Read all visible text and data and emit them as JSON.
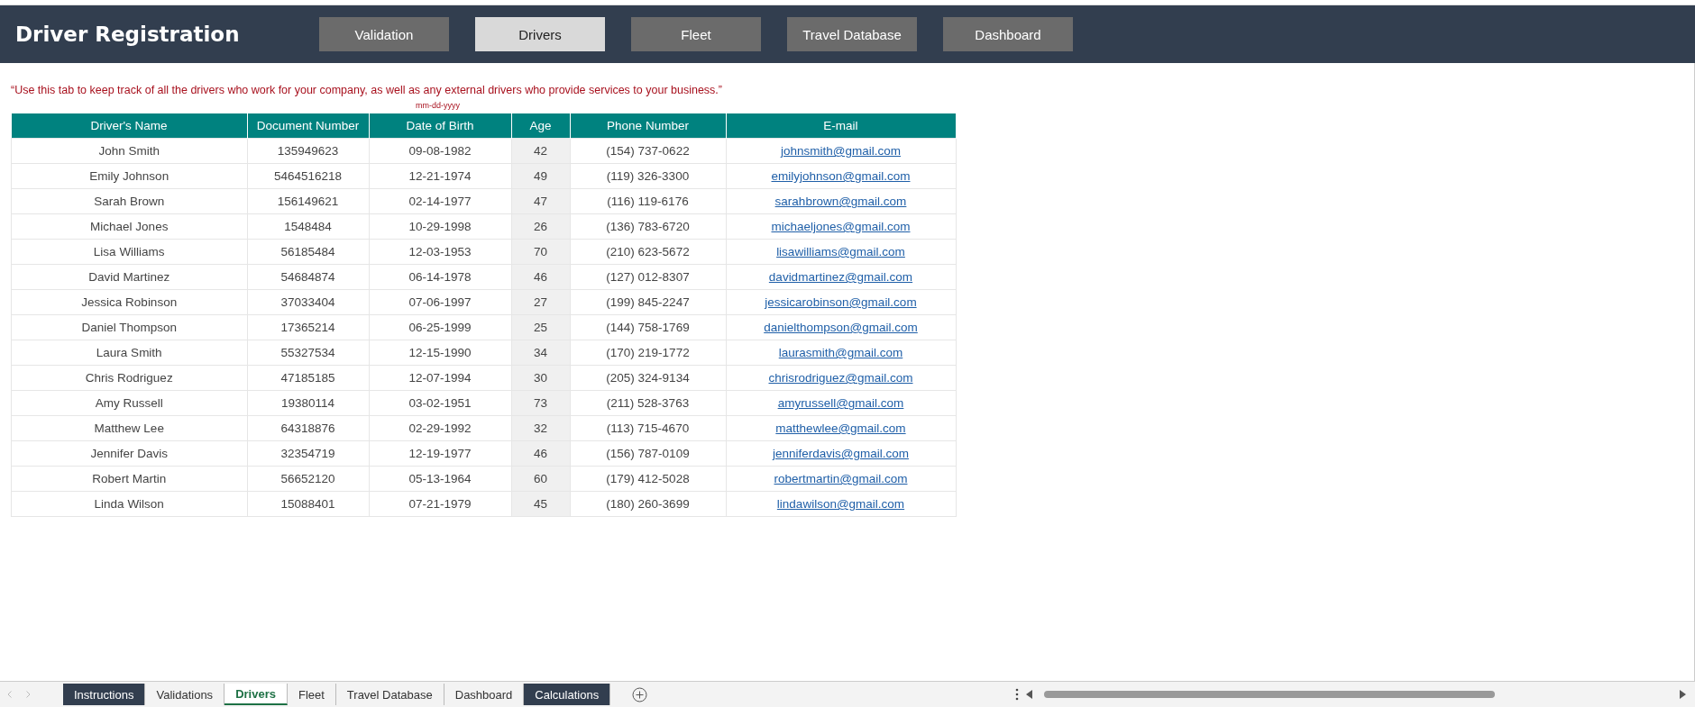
{
  "header": {
    "title": "Driver Registration",
    "nav_buttons": [
      {
        "label": "Validation",
        "selected": false
      },
      {
        "label": "Drivers",
        "selected": true
      },
      {
        "label": "Fleet",
        "selected": false
      },
      {
        "label": "Travel Database",
        "selected": false
      },
      {
        "label": "Dashboard",
        "selected": false
      }
    ]
  },
  "note": "“Use this tab to keep track of all the drivers who work for your company, as well as any external drivers who provide services to your business.”",
  "date_format_hint": "mm-dd-yyyy",
  "table": {
    "columns": [
      "Driver's Name",
      "Document Number",
      "Date of Birth",
      "Age",
      "Phone Number",
      "E-mail"
    ],
    "rows": [
      [
        "John Smith",
        "135949623",
        "09-08-1982",
        "42",
        "(154) 737-0622",
        "johnsmith@gmail.com"
      ],
      [
        "Emily Johnson",
        "5464516218",
        "12-21-1974",
        "49",
        "(119) 326-3300",
        "emilyjohnson@gmail.com"
      ],
      [
        "Sarah Brown",
        "156149621",
        "02-14-1977",
        "47",
        "(116) 119-6176",
        "sarahbrown@gmail.com"
      ],
      [
        "Michael Jones",
        "1548484",
        "10-29-1998",
        "26",
        "(136) 783-6720",
        "michaeljones@gmail.com"
      ],
      [
        "Lisa Williams",
        "56185484",
        "12-03-1953",
        "70",
        "(210) 623-5672",
        "lisawilliams@gmail.com"
      ],
      [
        "David Martinez",
        "54684874",
        "06-14-1978",
        "46",
        "(127) 012-8307",
        "davidmartinez@gmail.com"
      ],
      [
        "Jessica Robinson",
        "37033404",
        "07-06-1997",
        "27",
        "(199) 845-2247",
        "jessicarobinson@gmail.com"
      ],
      [
        "Daniel Thompson",
        "17365214",
        "06-25-1999",
        "25",
        "(144) 758-1769",
        "danielthompson@gmail.com"
      ],
      [
        "Laura Smith",
        "55327534",
        "12-15-1990",
        "34",
        "(170) 219-1772",
        "laurasmith@gmail.com"
      ],
      [
        "Chris Rodriguez",
        "47185185",
        "12-07-1994",
        "30",
        "(205) 324-9134",
        "chrisrodriguez@gmail.com"
      ],
      [
        "Amy Russell",
        "19380114",
        "03-02-1951",
        "73",
        "(211) 528-3763",
        "amyrussell@gmail.com"
      ],
      [
        "Matthew Lee",
        "64318876",
        "02-29-1992",
        "32",
        "(113) 715-4670",
        "matthewlee@gmail.com"
      ],
      [
        "Jennifer Davis",
        "32354719",
        "12-19-1977",
        "46",
        "(156) 787-0109",
        "jenniferdavis@gmail.com"
      ],
      [
        "Robert Martin",
        "56652120",
        "05-13-1964",
        "60",
        "(179) 412-5028",
        "robertmartin@gmail.com"
      ],
      [
        "Linda Wilson",
        "15088401",
        "07-21-1979",
        "45",
        "(180) 260-3699",
        "lindawilson@gmail.com"
      ]
    ]
  },
  "sheet_tabs": [
    {
      "label": "Instructions",
      "kind": "dark",
      "selected": false
    },
    {
      "label": "Validations",
      "kind": "plain",
      "selected": false
    },
    {
      "label": "Drivers",
      "kind": "plain",
      "selected": true
    },
    {
      "label": "Fleet",
      "kind": "plain",
      "selected": false
    },
    {
      "label": "Travel Database",
      "kind": "plain",
      "selected": false
    },
    {
      "label": "Dashboard",
      "kind": "plain",
      "selected": false
    },
    {
      "label": "Calculations",
      "kind": "dark",
      "selected": false
    }
  ]
}
